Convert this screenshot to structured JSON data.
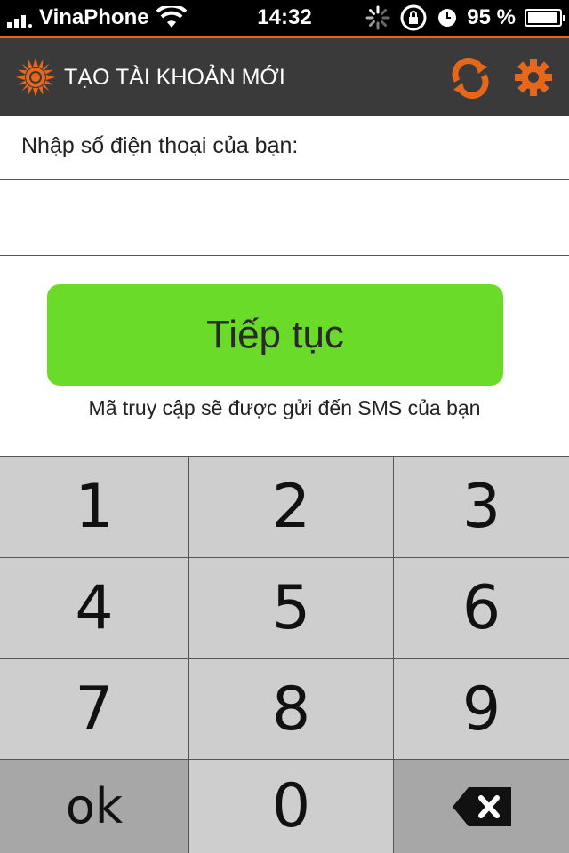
{
  "status": {
    "carrier": "VinaPhone",
    "time": "14:32",
    "battery_text": "95 %",
    "battery_level": 0.95
  },
  "header": {
    "title": "TẠO TÀI KHOẢN MỚI",
    "refresh_icon": "refresh-icon",
    "settings_icon": "gear-icon",
    "accent_color": "#e8661a"
  },
  "form": {
    "prompt": "Nhập số điện thoại của bạn:",
    "phone_value": "",
    "continue_label": "Tiếp tục",
    "hint": "Mã truy cập sẽ được gửi đến SMS của bạn",
    "button_color": "#6bdb2a"
  },
  "keypad": {
    "keys": [
      "1",
      "2",
      "3",
      "4",
      "5",
      "6",
      "7",
      "8",
      "9"
    ],
    "ok_label": "ok",
    "zero_label": "0",
    "backspace_icon": "backspace-icon"
  }
}
